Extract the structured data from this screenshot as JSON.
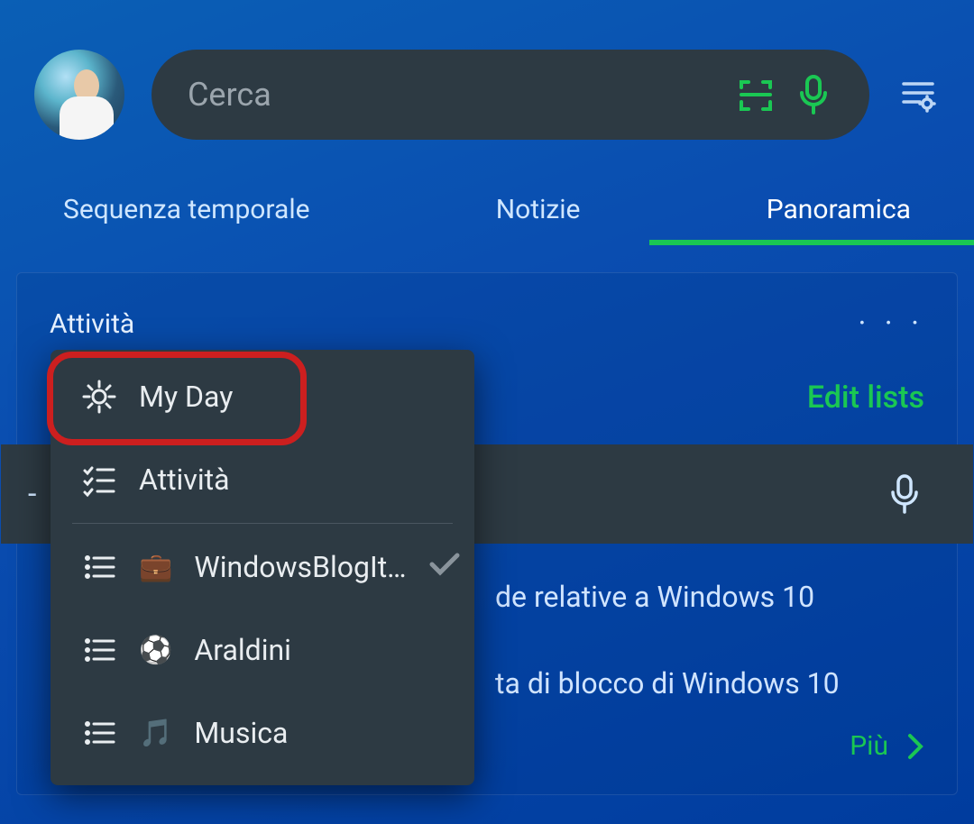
{
  "header": {
    "search_placeholder": "Cerca"
  },
  "tabs": {
    "items": [
      "Sequenza temporale",
      "Notizie",
      "Panoramica"
    ],
    "active_index": 2
  },
  "card": {
    "title": "Attività",
    "edit_lists": "Edit lists",
    "tasks": [
      "de relative a Windows 10",
      "ta di blocco di Windows 10"
    ],
    "more": "Più"
  },
  "dropdown": {
    "items": [
      {
        "label": "My Day",
        "icon": "sun"
      },
      {
        "label": "Attività",
        "icon": "tasks"
      },
      {
        "label": "WindowsBlogIt…",
        "icon": "list",
        "emoji": "💼",
        "checked": true
      },
      {
        "label": "Araldini",
        "icon": "list",
        "emoji": "⚽"
      },
      {
        "label": "Musica",
        "icon": "list",
        "emoji": "🎵"
      }
    ]
  },
  "icons": {
    "scan": "scan-icon",
    "mic": "mic-icon",
    "settings": "settings-list-icon",
    "sun": "sun-icon",
    "tasks": "tasks-icon",
    "list": "list-icon",
    "check": "check-icon",
    "chevron": "chevron-right-icon"
  },
  "colors": {
    "accent": "#1ac753",
    "panel": "#2d3a43"
  }
}
